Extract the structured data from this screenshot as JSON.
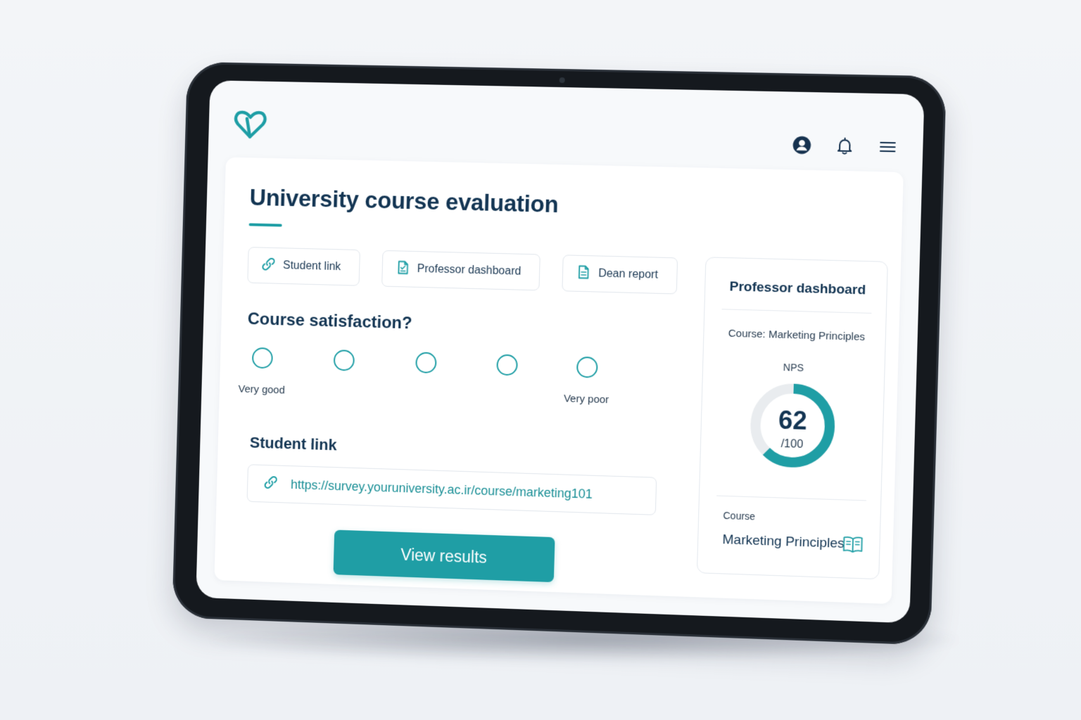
{
  "page": {
    "title": "University course evaluation"
  },
  "header": {
    "icons": [
      "logo-heart-icon",
      "user-icon",
      "bell-icon",
      "menu-icon"
    ]
  },
  "tabs": [
    {
      "label": "Student link",
      "icon": "link-icon"
    },
    {
      "label": "Professor dashboard",
      "icon": "document-icon"
    },
    {
      "label": "Dean report",
      "icon": "document-icon"
    }
  ],
  "survey": {
    "question": "Course satisfaction?",
    "options": 5,
    "label_first": "Very good",
    "label_last": "Very poor"
  },
  "student_link": {
    "heading": "Student link",
    "url": "https://survey.youruniversity.ac.ir/course/marketing101"
  },
  "actions": {
    "view_results": "View results"
  },
  "dashboard_card": {
    "title": "Professor dashboard",
    "course_line": "Course: Marketing Principles",
    "nps_label": "NPS",
    "nps_value": "62",
    "nps_max": "/100",
    "nps_fraction": 0.62,
    "course_label": "Course",
    "course_name": "Marketing Principles"
  },
  "colors": {
    "accent": "#1f9ea5",
    "title": "#133553",
    "ring_track": "#e9ecef"
  }
}
